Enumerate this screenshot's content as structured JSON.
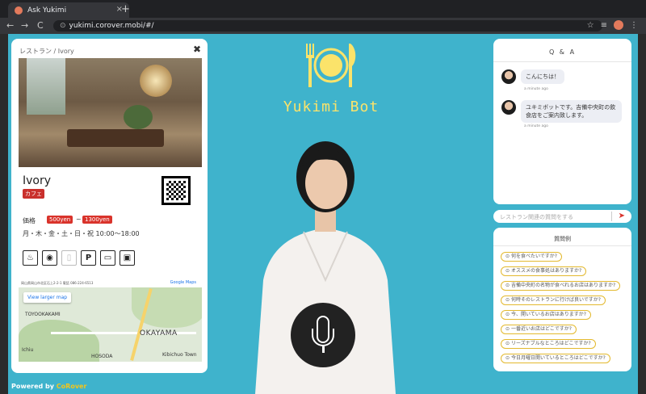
{
  "browser": {
    "tab_title": "Ask Yukimi",
    "tab_close": "×",
    "new_tab": "+",
    "url": "yukimi.corover.mobi/#/",
    "back": "←",
    "forward": "→",
    "reload": "C",
    "lock": "🔒"
  },
  "restaurant": {
    "breadcrumb": "レストラン / Ivory",
    "close": "✖",
    "name": "Ivory",
    "category": "カフェ",
    "price_label": "価格",
    "price_low": "500yen",
    "price_sep": "~",
    "price_high": "1300yen",
    "hours": "月・木・金・土・日・祝 10:00～18:00",
    "address": "岡山県岡山市北区石上2-2-1 電話 086-224-6513",
    "google_maps_link": "Google Maps",
    "view_larger_map": "View larger map",
    "map_labels": [
      "TOYOOKAKAMI",
      "OKAYAMA",
      "HOSODA",
      "Kibichuo Town",
      "Ichiu"
    ],
    "amenity_icons": [
      "parking-P",
      "card",
      "takeout"
    ]
  },
  "powered": {
    "prefix": "Powered by",
    "brand": "CoRover"
  },
  "bot": {
    "title": "Yukimi Bot"
  },
  "qa": {
    "title": "Q & A",
    "messages": [
      {
        "text": "こんにちは！",
        "time": "a minute ago"
      },
      {
        "text": "ユキミボットです。吉備中央町の飲食店をご案内致します。",
        "time": "a minute ago"
      }
    ],
    "input_placeholder": "レストラン関連の質問をする",
    "send_icon": "➤"
  },
  "suggestions": {
    "title": "質問例",
    "items": [
      "何を食べたいですか?",
      "オススメの食事処はありますか?",
      "吉備中央町の名物が食べれるお店はありますか?",
      "何時そのレストランに行けば良いですか?",
      "今、開いているお店はありますか?",
      "一番近いお店はどこですか?",
      "リーズナブルなところはどこですか?",
      "今日月曜日開いているところはどこですか?"
    ]
  },
  "colors": {
    "page_bg": "#3fb3cc",
    "bot_yellow": "#fbe36a",
    "price_red": "#d9332b",
    "chip_border": "#e3b92e"
  }
}
